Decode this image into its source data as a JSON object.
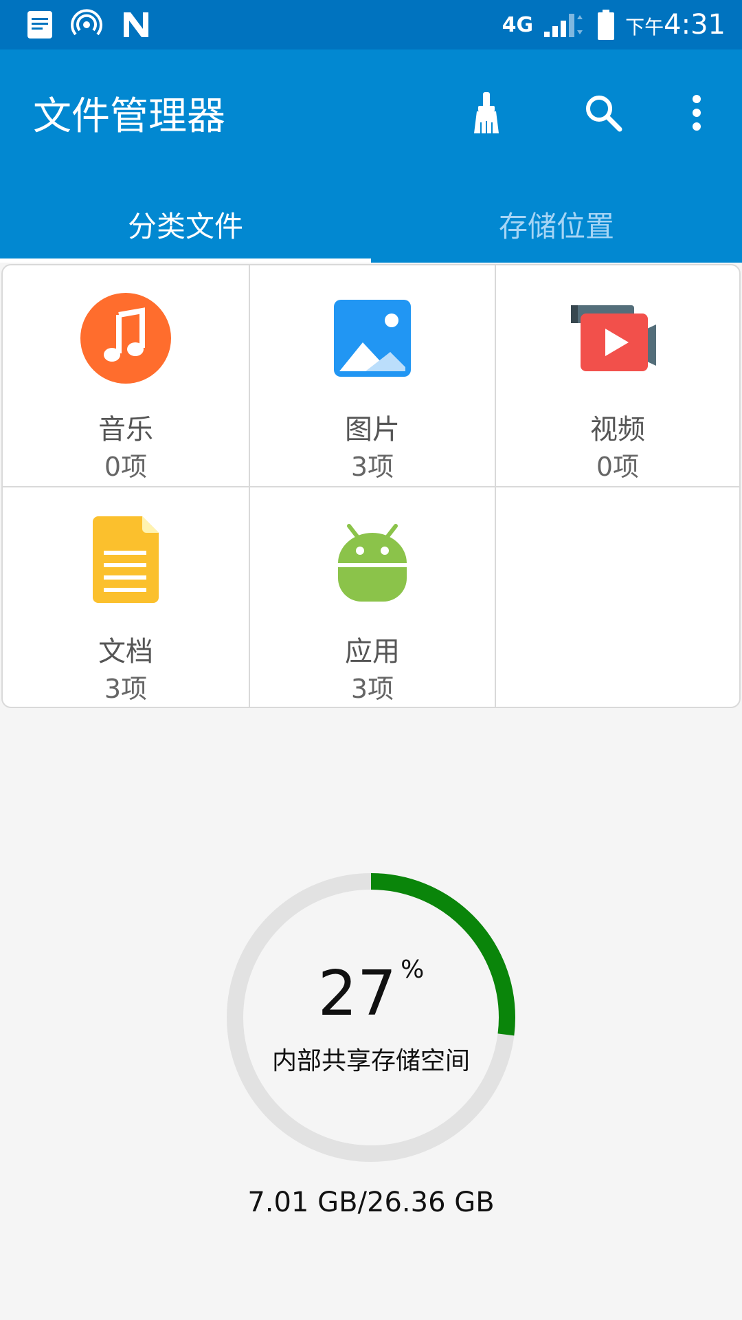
{
  "status_bar": {
    "network": "4G",
    "time_prefix": "下午",
    "time": "4:31",
    "left_icons": [
      "notes-icon",
      "hotspot-icon",
      "nfc-n-icon"
    ]
  },
  "app_bar": {
    "title": "文件管理器",
    "actions": [
      "broom-clean-icon",
      "search-icon",
      "more-vert-icon"
    ]
  },
  "tabs": [
    {
      "label": "分类文件",
      "active": true
    },
    {
      "label": "存储位置",
      "active": false
    }
  ],
  "categories": [
    {
      "label": "音乐",
      "count": "0项",
      "icon": "music-icon"
    },
    {
      "label": "图片",
      "count": "3项",
      "icon": "image-icon"
    },
    {
      "label": "视频",
      "count": "0项",
      "icon": "video-icon"
    },
    {
      "label": "文档",
      "count": "3项",
      "icon": "document-icon"
    },
    {
      "label": "应用",
      "count": "3项",
      "icon": "android-icon"
    }
  ],
  "storage": {
    "percent": "27",
    "percent_symbol": "%",
    "percent_value": 0.27,
    "label": "内部共享存储空间",
    "usage": "7.01 GB/26.36 GB"
  },
  "colors": {
    "status_bar": "#0073bf",
    "app_bar": "#0288d1",
    "ring_fill": "#0a850a",
    "ring_track": "#e2e2e2"
  }
}
